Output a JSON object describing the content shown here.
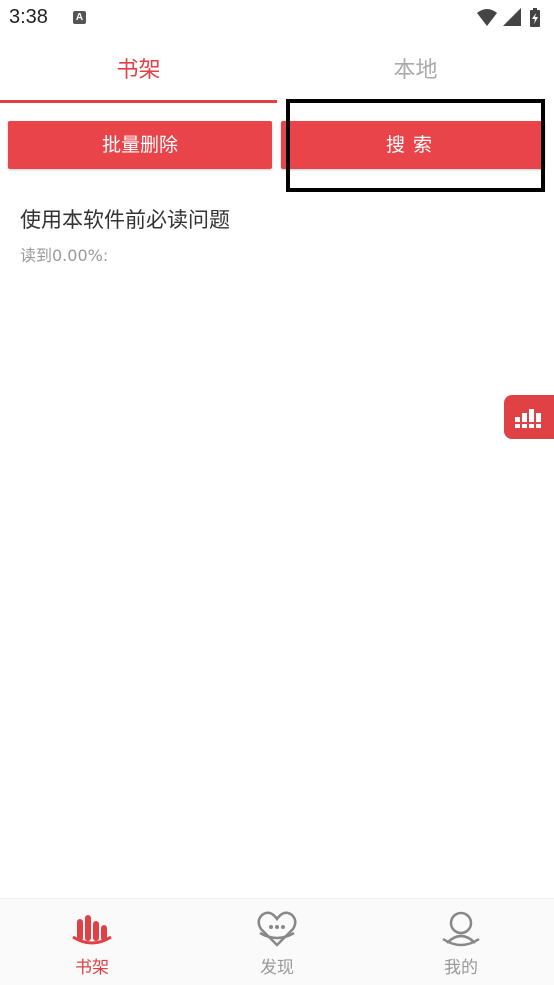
{
  "status_bar": {
    "time": "3:38",
    "notification_icon": "a-icon",
    "icons": [
      "wifi-icon",
      "signal-icon",
      "battery-charging-icon"
    ]
  },
  "tabs": [
    {
      "label": "书架",
      "active": true
    },
    {
      "label": "本地",
      "active": false
    }
  ],
  "actions": {
    "batch_delete_label": "批量删除",
    "search_label": "搜索"
  },
  "books": [
    {
      "title": "使用本软件前必读问题",
      "progress": "读到0.00%:"
    }
  ],
  "float_button": {
    "icon": "equalizer-icon"
  },
  "bottom_nav": [
    {
      "label": "书架",
      "icon": "bookshelf-icon",
      "active": true
    },
    {
      "label": "发现",
      "icon": "heart-smile-icon",
      "active": false
    },
    {
      "label": "我的",
      "icon": "user-icon",
      "active": false
    }
  ],
  "colors": {
    "accent": "#e04145",
    "button": "#e8444a",
    "inactive": "#999999"
  }
}
